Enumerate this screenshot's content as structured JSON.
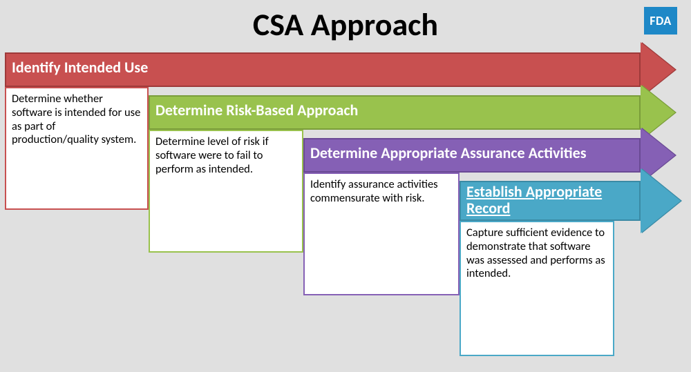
{
  "title": "CSA Approach",
  "badge": "FDA",
  "steps": [
    {
      "label": "Identify Intended Use",
      "desc": "Determine whether software is intended for use as part of production/quality system."
    },
    {
      "label": "Determine Risk-Based Approach",
      "desc": "Determine level of risk if software were to fail to perform as intended."
    },
    {
      "label": "Determine Appropriate Assurance Activities",
      "desc": "Identify assurance activities commensurate with risk."
    },
    {
      "label": "Establish Appropriate Record",
      "desc": "Capture sufficient evidence to demonstrate that software was assessed and performs as intended."
    }
  ]
}
